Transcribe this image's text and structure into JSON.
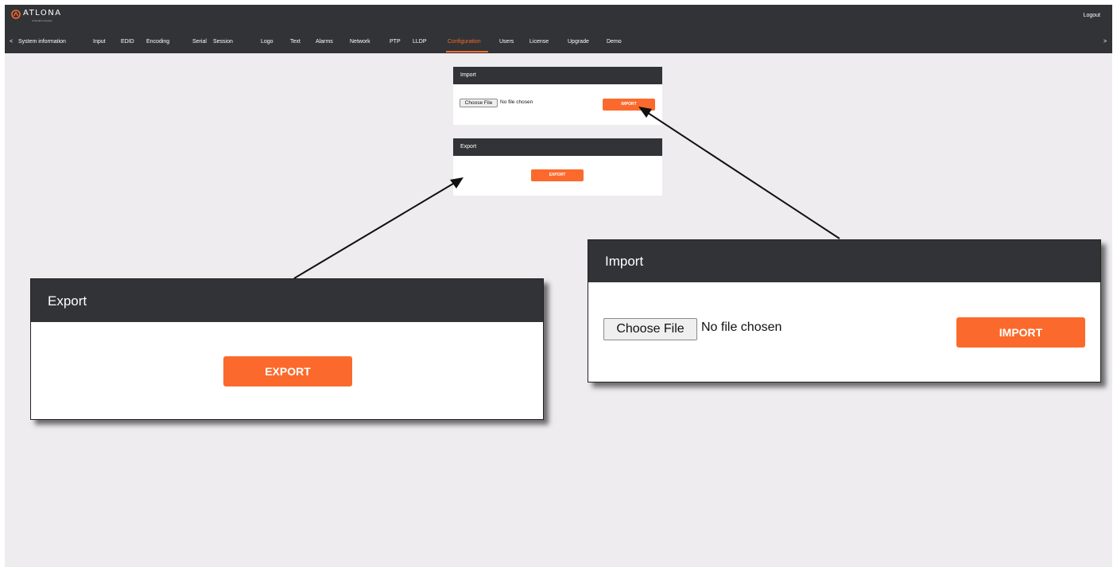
{
  "app": {
    "logo_text": "ATLONA",
    "logo_sub": "a Panduit company",
    "logout_label": "Logout"
  },
  "nav": {
    "prev_arrow": "<",
    "next_arrow": ">",
    "items": [
      "System information",
      "Input",
      "EDID",
      "Encoding",
      "Serial",
      "Session",
      "Logo",
      "Text",
      "Alarms",
      "Network",
      "PTP",
      "LLDP",
      "Configuration",
      "Users",
      "License",
      "Upgrade",
      "Demo"
    ],
    "active": "Configuration"
  },
  "import_panel": {
    "title": "Import",
    "choose_file_label": "Choose File",
    "file_status": "No file chosen",
    "button_label": "IMPORT"
  },
  "export_panel": {
    "title": "Export",
    "button_label": "EXPORT"
  },
  "colors": {
    "accent": "#fb6a2c",
    "header_bg": "#323336",
    "page_bg": "#eeecef"
  }
}
